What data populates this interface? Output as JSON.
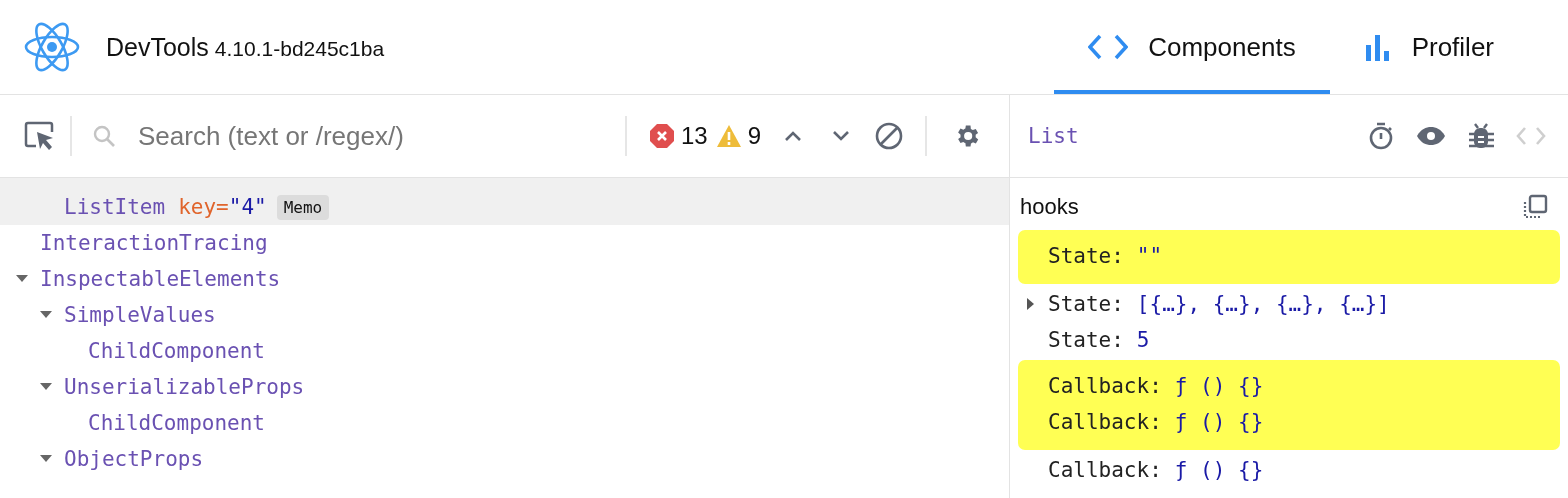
{
  "header": {
    "title": "DevTools",
    "version": "4.10.1-bd245c1ba"
  },
  "tabs": [
    {
      "label": "Components",
      "kind": "components",
      "selected": true
    },
    {
      "label": "Profiler",
      "kind": "profiler",
      "selected": false
    }
  ],
  "toolbar": {
    "search_placeholder": "Search (text or /regex/)",
    "errors": "13",
    "warnings": "9"
  },
  "tree": [
    {
      "children": [
        {
          "name": "ListItem",
          "prop": {
            "name": "key=",
            "value": "\"4\""
          },
          "badge": "Memo",
          "selected": true
        }
      ]
    },
    {
      "name": "InteractionTracing",
      "selected": false
    },
    {
      "name": "InspectableElements",
      "selected": false,
      "expanded": true,
      "children": [
        {
          "name": "SimpleValues",
          "selected": false,
          "expanded": true,
          "children": [
            {
              "name": "ChildComponent",
              "selected": false
            }
          ]
        },
        {
          "name": "UnserializableProps",
          "selected": false,
          "expanded": true,
          "children": [
            {
              "name": "ChildComponent",
              "selected": false
            }
          ]
        },
        {
          "name": "ObjectProps",
          "selected": false,
          "expanded": true
        }
      ]
    }
  ],
  "inspector": {
    "component": "List",
    "section": "hooks",
    "hooks": [
      {
        "name": "State:",
        "value": "\"\"",
        "highlighted": true
      },
      {
        "name": "State:",
        "value": "[{…}, {…}, {…}, {…}]",
        "highlighted": false,
        "expanded": false
      },
      {
        "name": "State:",
        "value": "5",
        "highlighted": false
      },
      {
        "name": "Callback:",
        "value": "ƒ () {}",
        "highlighted": true
      },
      {
        "name": "Callback:",
        "value": "ƒ () {}",
        "highlighted": true
      },
      {
        "name": "Callback:",
        "value": "ƒ () {}",
        "highlighted": false
      }
    ]
  }
}
